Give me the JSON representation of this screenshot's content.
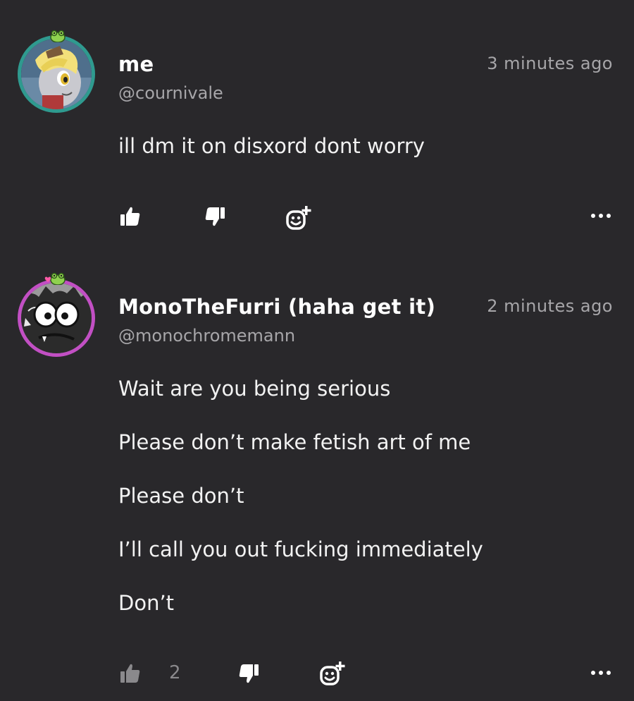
{
  "comments": [
    {
      "name": "me",
      "handle": "@cournivale",
      "time": "3 minutes ago",
      "lines": [
        "ill dm it on disxord dont worry"
      ],
      "likes": "",
      "avatar_icon": "pony-avatar",
      "ring_color": "#2f9a8f"
    },
    {
      "name": "MonoTheFurri (haha get it)",
      "handle": "@monochromemann",
      "time": "2 minutes ago",
      "lines": [
        "Wait are you being serious",
        "Please don’t make fetish art of me",
        "Please don’t",
        "I’ll call you out fucking immediately",
        "Don’t"
      ],
      "likes": "2",
      "avatar_icon": "cartoon-cat-avatar",
      "ring_color": "#c24fc4"
    }
  ],
  "icons": {
    "like": "thumbs-up-icon",
    "dislike": "thumbs-down-icon",
    "react": "add-reaction-icon",
    "more": "more-options-icon",
    "badge": "frog-badge-icon"
  }
}
